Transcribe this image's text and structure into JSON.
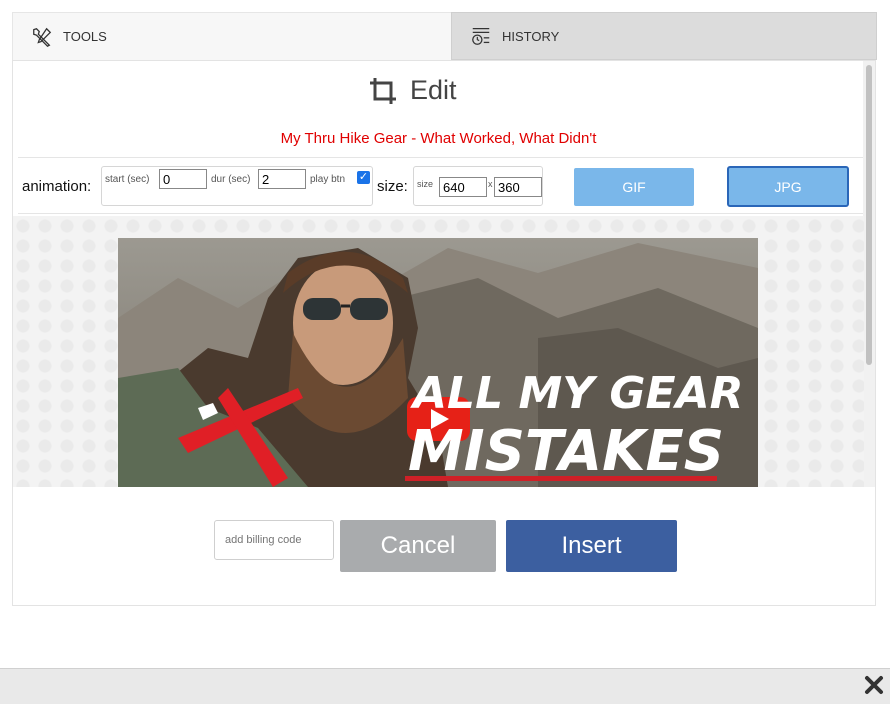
{
  "tabs": [
    {
      "label": "TOOLS",
      "icon": "tools-icon"
    },
    {
      "label": "HISTORY",
      "icon": "history-icon"
    }
  ],
  "edit": {
    "title": "Edit",
    "icon": "crop-icon",
    "video_title": "My Thru Hike Gear - What Worked, What Didn't"
  },
  "controls": {
    "animation_label": "animation:",
    "start_label": "start (sec)",
    "start_value": "0",
    "dur_label": "dur (sec)",
    "dur_value": "2",
    "play_btn_label": "play btn",
    "play_btn_checked": true,
    "size_label": "size:",
    "size_small_label": "size",
    "width_value": "640",
    "x_sep": "x",
    "height_value": "360",
    "gif_label": "GIF",
    "jpg_label": "JPG"
  },
  "thumbnail": {
    "overlay_line1": "ALL MY GEAR",
    "overlay_line2": "MISTAKES"
  },
  "footer": {
    "billing_placeholder": "add billing code",
    "cancel_label": "Cancel",
    "insert_label": "Insert"
  },
  "colors": {
    "title_red": "#e00000",
    "button_blue": "#7ab7ea",
    "insert_blue": "#3c5fa0",
    "cancel_gray": "#a9abad"
  }
}
